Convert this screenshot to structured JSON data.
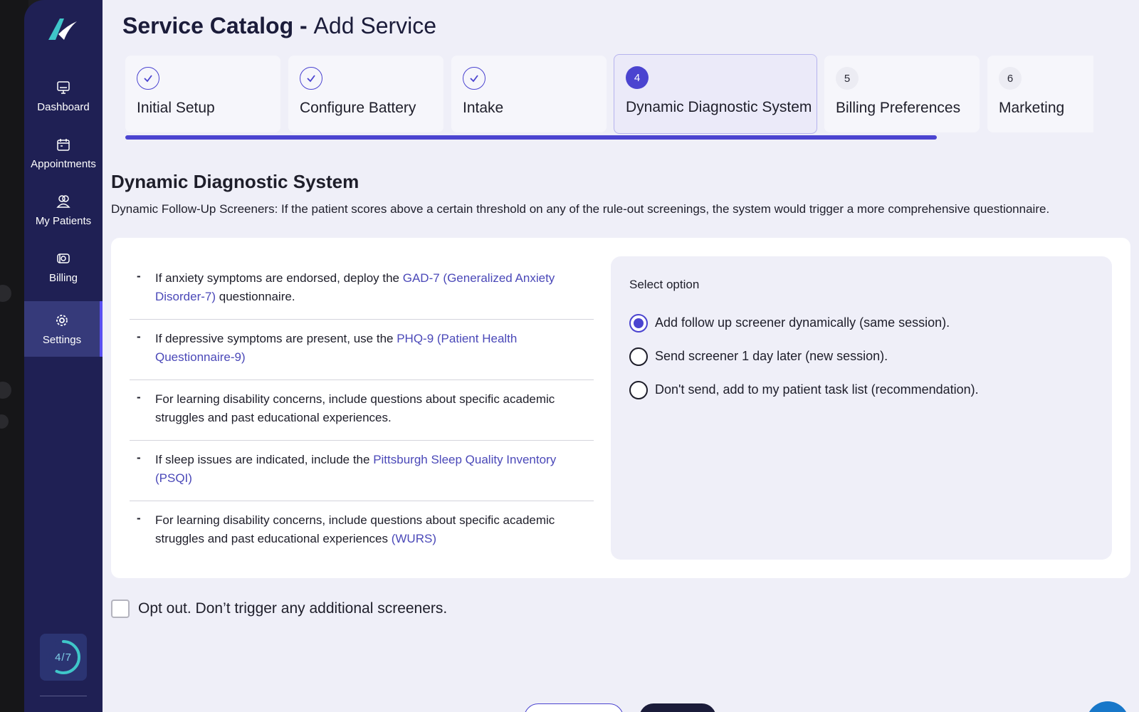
{
  "sidebar": {
    "items": [
      {
        "label": "Dashboard",
        "icon": "monitor-icon"
      },
      {
        "label": "Appointments",
        "icon": "calendar-icon"
      },
      {
        "label": "My Patients",
        "icon": "users-icon"
      },
      {
        "label": "Billing",
        "icon": "billing-icon"
      },
      {
        "label": "Settings",
        "icon": "gear-icon",
        "active": true
      }
    ],
    "progress": {
      "text": "4/7",
      "fraction": 0.57
    }
  },
  "header": {
    "title_bold": "Service Catalog -",
    "title_light": "Add Service"
  },
  "stepper": {
    "steps": [
      {
        "number": "",
        "label": "Initial Setup",
        "state": "done"
      },
      {
        "number": "",
        "label": "Configure Battery",
        "state": "done"
      },
      {
        "number": "",
        "label": "Intake",
        "state": "done"
      },
      {
        "number": "4",
        "label": "Dynamic Diagnostic System",
        "state": "current"
      },
      {
        "number": "5",
        "label": "Billing Preferences",
        "state": "todo"
      },
      {
        "number": "6",
        "label": "Marketing",
        "state": "todo"
      }
    ]
  },
  "section": {
    "title": "Dynamic Diagnostic System",
    "description": "Dynamic Follow-Up Screeners: If the patient scores above a certain threshold on any of the rule-out screenings, the system would trigger a more comprehensive questionnaire."
  },
  "rules": [
    {
      "dash": "-",
      "before": "If anxiety symptoms are endorsed, deploy the ",
      "link": "GAD-7 (Generalized Anxiety Disorder-7)",
      "after": " questionnaire."
    },
    {
      "dash": "-",
      "before": "If depressive symptoms are present, use the ",
      "link": "PHQ-9 (Patient Health Questionnaire-9)",
      "after": ""
    },
    {
      "dash": "-",
      "before": "For learning disability concerns, include questions about specific academic struggles and past educational experiences.",
      "link": "",
      "after": ""
    },
    {
      "dash": "-",
      "before": "If sleep issues are indicated, include the ",
      "link": "Pittsburgh Sleep Quality Inventory (PSQI)",
      "after": ""
    },
    {
      "dash": "-",
      "before": "For learning disability concerns, include questions about specific academic struggles and past educational experiences ",
      "link": "(WURS)",
      "after": ""
    }
  ],
  "options": {
    "title": "Select option",
    "items": [
      {
        "label": "Add follow up screener dynamically (same session).",
        "checked": true
      },
      {
        "label": "Send screener 1 day later (new session).",
        "checked": false
      },
      {
        "label": "Don't send, add to my patient task list (recommendation).",
        "checked": false
      }
    ]
  },
  "optout": {
    "label": "Opt out. Don’t trigger any additional screeners.",
    "checked": false
  },
  "colors": {
    "accent": "#4b44d0",
    "sidebar": "#1f2054",
    "link": "#4a48b8"
  }
}
